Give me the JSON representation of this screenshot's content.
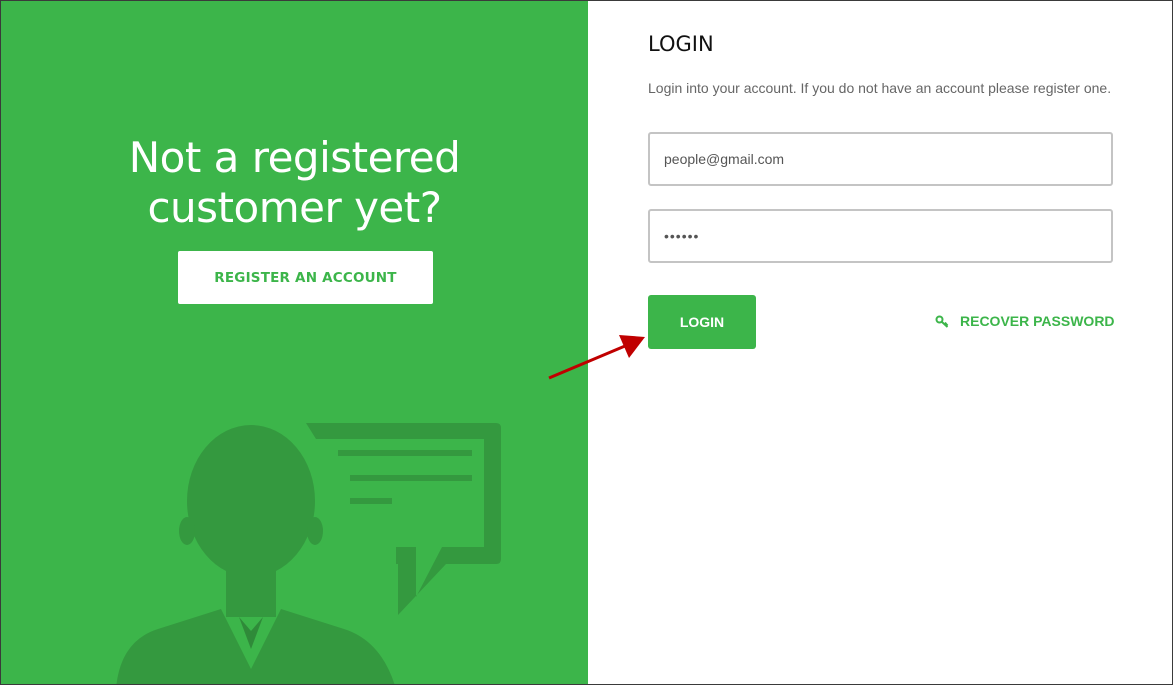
{
  "promo": {
    "headline_line1": "Not a registered",
    "headline_line2": "customer yet?",
    "register_button": "REGISTER AN ACCOUNT"
  },
  "login": {
    "title": "LOGIN",
    "intro": "Login into your account. If you do not have an account please register one.",
    "email_value": "people@gmail.com",
    "password_mask": "••••••",
    "login_button": "LOGIN",
    "recover_link": "RECOVER PASSWORD"
  },
  "icons": {
    "recover": "key-icon",
    "illustration": "person-with-speech-bubble",
    "annotation": "red-arrow"
  },
  "colors": {
    "brand_green": "#3cb54a",
    "illustration_green": "#34993f",
    "arrow_red": "#c00000"
  }
}
